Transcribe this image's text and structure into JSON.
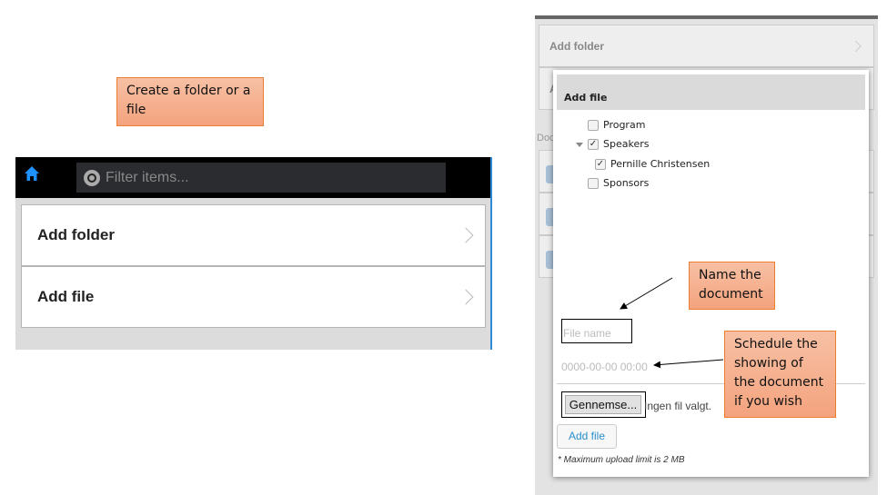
{
  "callouts": {
    "create": "Create a folder or a file",
    "name": "Name the document",
    "schedule": "Schedule the showing of the document if you wish"
  },
  "left": {
    "filter_placeholder": "Filter items...",
    "items": [
      {
        "label": "Add folder"
      },
      {
        "label": "Add file"
      }
    ],
    "accent": "#1e90ff"
  },
  "right": {
    "bg_items": [
      "Add folder",
      "A"
    ],
    "section_label": "Doc",
    "dialog": {
      "title": "Add file",
      "tree": [
        {
          "label": "Program",
          "checked": false
        },
        {
          "label": "Speakers",
          "checked": true,
          "expanded": true
        },
        {
          "label": "Pernille Christensen",
          "checked": true
        },
        {
          "label": "Sponsors",
          "checked": false
        }
      ],
      "file_name_placeholder": "File name",
      "date_placeholder": "0000-00-00 00:00",
      "browse_label": "Gennemse...",
      "no_file": "Ingen fil valgt.",
      "add_button": "Add file",
      "limit_note": "* Maximum upload limit is 2 MB"
    }
  }
}
